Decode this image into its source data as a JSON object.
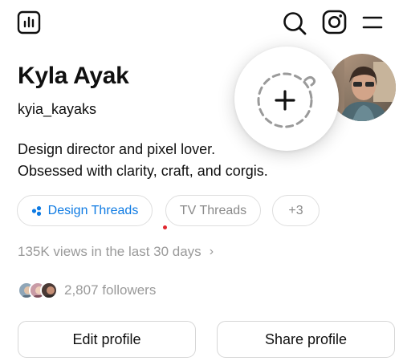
{
  "profile": {
    "name": "Kyla Ayak",
    "handle": "kyia_kayaks",
    "bio_line1": "Design director and pixel lover.",
    "bio_line2": "Obsessed with clarity, craft, and corgis."
  },
  "chips": [
    {
      "label": "Design Threads",
      "active": true
    },
    {
      "label": "TV Threads",
      "active": false
    },
    {
      "label": "+3",
      "active": false
    }
  ],
  "stats": {
    "views": "135K views in the last 30 days",
    "followers": "2,807 followers"
  },
  "actions": {
    "edit_label": "Edit profile",
    "share_label": "Share profile"
  },
  "icons": {
    "top_left": "insights-chart-icon",
    "search": "search-icon",
    "instagram": "instagram-icon",
    "menu": "menu-icon",
    "add_story": "plus-icon",
    "views_chevron": "chevron-right-icon"
  },
  "colors": {
    "accent": "#0f7be3",
    "muted": "#9a9a9a",
    "notification": "#e0262e"
  }
}
